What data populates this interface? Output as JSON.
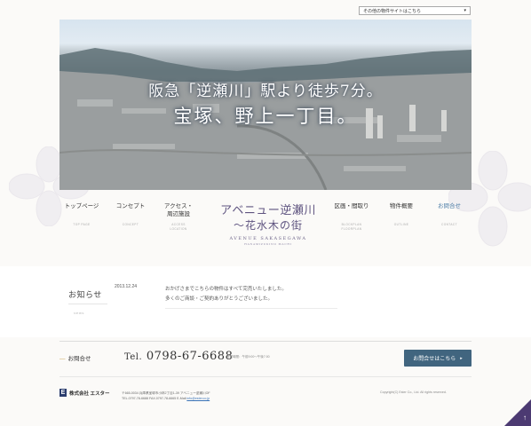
{
  "header": {
    "site_select": "その他の物件サイトはこちら"
  },
  "hero": {
    "line1": "阪急「逆瀬川」駅より徒歩7分。",
    "line2": "宝塚、野上一丁目。"
  },
  "nav": {
    "items": [
      {
        "jp": "トップページ",
        "en": "TOP PAGE"
      },
      {
        "jp": "コンセプト",
        "en": "CONCEPT"
      },
      {
        "jp": "アクセス・\n周辺施設",
        "en": "ACCESS\nLOCATION"
      },
      {
        "jp": "区画・間取り",
        "en": "BLOCKPLAN\nFLOORPLAN"
      },
      {
        "jp": "物件概要",
        "en": "OUTLINE"
      },
      {
        "jp": "お問合せ",
        "en": "CONTACT"
      }
    ]
  },
  "logo": {
    "line1": "アベニュー逆瀬川",
    "line2": "〜花水木の街",
    "en1": "AVENUE SAKASEGAWA",
    "en2": "HANAMIZUKINO MACHI"
  },
  "news": {
    "title": "お知らせ",
    "title_en": "NEWS",
    "date": "2013.12.24",
    "body_line1": "おかげさまでこちらの物件はすべて完売いたしました。",
    "body_line2": "多くのご商談・ご契約ありがとうございました。"
  },
  "contact": {
    "label": "お問合せ",
    "tel_prefix": "Tel.",
    "tel": "0798-67-6688",
    "hours": "営業時間：午前9:00〜午後7:00",
    "button": "お問合せはこちら",
    "button_arrow": "▸"
  },
  "footer": {
    "company": "株式会社 エスター",
    "mark": "E",
    "address": "〒665-0034 兵庫県宝塚市小林2丁目1-39 アベニュー逆瀬川OF",
    "tel_fax": "TEL.0797-78-6688  FAX.0797-78-6665  E-Mail:",
    "email": "info@ester.co.jp",
    "copyright": "Copyright(C) Ester Co., Ltd. All rights reserved."
  },
  "pagetop": {
    "arrow": "↑"
  },
  "colors": {
    "accent": "#41657f",
    "logo": "#5f5480",
    "active_nav": "#4f7fa8",
    "corner": "#4c3a72"
  }
}
